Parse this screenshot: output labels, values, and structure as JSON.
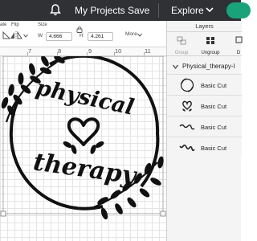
{
  "topbar": {
    "my_projects": "My Projects",
    "save": "Save",
    "explore": "Explore",
    "bg": "#2f3134",
    "accent": "#1aa37a"
  },
  "toolbar": {
    "rotate_label": "ate",
    "flip_label": "Flip",
    "size_label": "Size",
    "w_letter": "W",
    "w_value": "4.666",
    "h_letter": "H",
    "h_value": "4.261",
    "more_label": "More"
  },
  "ruler": {
    "numbers": [
      "7",
      "8",
      "9",
      "10",
      "11"
    ]
  },
  "design": {
    "line1": "physical",
    "line2": "therapy"
  },
  "layers_panel": {
    "title": "Layers",
    "tools": {
      "group": "Group",
      "ungroup": "Ungroup",
      "partial": "D"
    },
    "group_name": "Physical_therapy-l",
    "items": [
      {
        "label": "Basic Cut",
        "icon": "wreath-thumb-icon"
      },
      {
        "label": "Basic Cut",
        "icon": "heart-thumb-icon"
      },
      {
        "label": "Basic Cut",
        "icon": "physical-text-thumb-icon"
      },
      {
        "label": "Basic Cut",
        "icon": "therapy-text-thumb-icon"
      }
    ]
  }
}
